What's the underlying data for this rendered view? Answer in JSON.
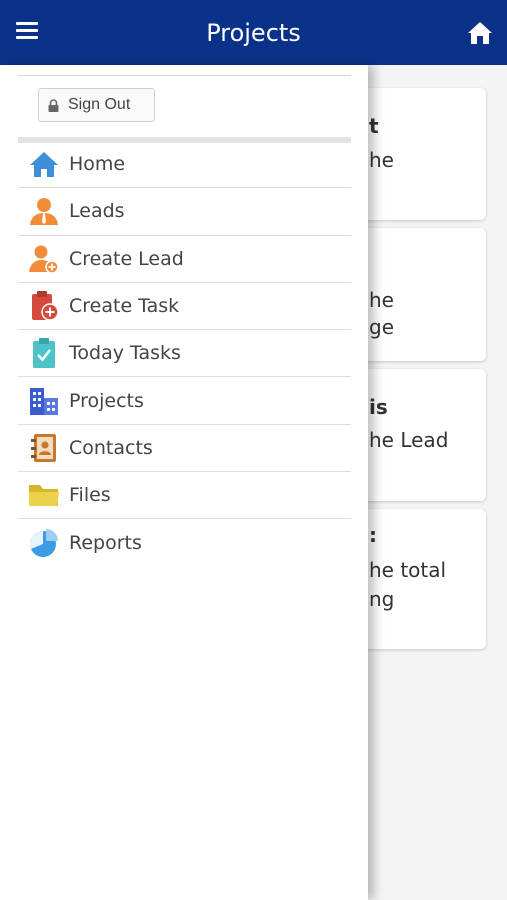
{
  "header": {
    "title": "Projects",
    "menu_icon": "hamburger-menu-icon",
    "home_icon": "home-icon"
  },
  "drawer": {
    "signout_label": "Sign Out",
    "items": [
      {
        "label": "Home",
        "icon": "home-icon"
      },
      {
        "label": "Leads",
        "icon": "lead-person-icon"
      },
      {
        "label": "Create Lead",
        "icon": "create-lead-icon"
      },
      {
        "label": "Create Task",
        "icon": "create-task-icon"
      },
      {
        "label": "Today Tasks",
        "icon": "today-tasks-icon"
      },
      {
        "label": "Projects",
        "icon": "buildings-icon"
      },
      {
        "label": "Contacts",
        "icon": "contacts-book-icon"
      },
      {
        "label": "Files",
        "icon": "folder-icon"
      },
      {
        "label": "Reports",
        "icon": "pie-chart-icon"
      }
    ]
  },
  "background_cards": [
    {
      "line1": "t",
      "line2": "he"
    },
    {
      "line1": "he",
      "line2": "ge"
    },
    {
      "line1": "is",
      "line2": "he Lead"
    },
    {
      "line1": ":",
      "line2": "he total",
      "line3": "ng"
    }
  ],
  "colors": {
    "header": "#0a3288",
    "home_icon": "#3f8fd8",
    "lead_icon": "#f28c38",
    "task_icon": "#d64a3b",
    "today_icon": "#4cc3c9",
    "projects_icon": "#3b5ccf",
    "contacts_icon": "#c8772e",
    "files_icon": "#e9c935",
    "reports_icon": "#3a9be6"
  }
}
